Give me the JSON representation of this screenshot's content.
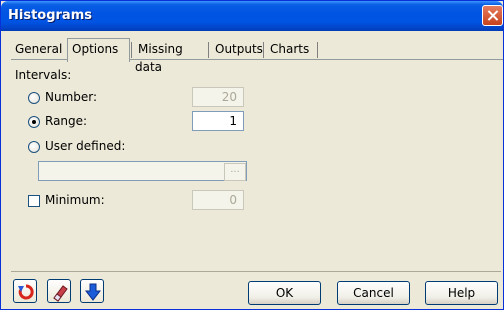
{
  "window": {
    "title": "Histograms"
  },
  "tabs": [
    {
      "label": "General"
    },
    {
      "label": "Options"
    },
    {
      "label": "Missing data"
    },
    {
      "label": "Outputs"
    },
    {
      "label": "Charts"
    }
  ],
  "options": {
    "intervals_label": "Intervals:",
    "number": {
      "label": "Number:",
      "value": "20",
      "selected": false
    },
    "range": {
      "label": "Range:",
      "value": "1",
      "selected": true
    },
    "user_defined": {
      "label": "User defined:",
      "value": "",
      "browse": "..."
    },
    "minimum": {
      "label": "Minimum:",
      "value": "0",
      "checked": false
    }
  },
  "footer": {
    "ok": "OK",
    "cancel": "Cancel",
    "help": "Help",
    "icons": [
      "reset-icon",
      "eraser-icon",
      "down-arrow-icon"
    ]
  }
}
